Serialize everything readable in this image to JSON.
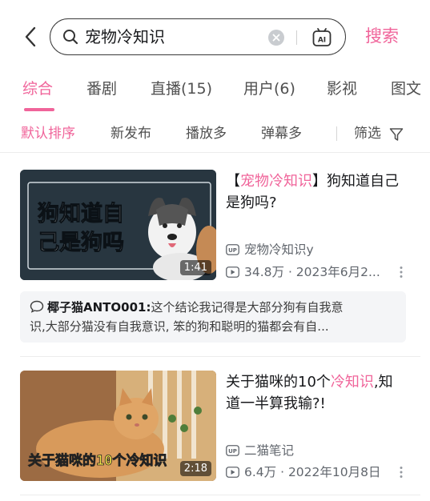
{
  "search": {
    "query": "宠物冷知识",
    "button_label": "搜索",
    "ai_label": "AI"
  },
  "tabs": [
    {
      "label": "综合",
      "active": true
    },
    {
      "label": "番剧",
      "active": false
    },
    {
      "label": "直播(15)",
      "active": false
    },
    {
      "label": "用户(6)",
      "active": false
    },
    {
      "label": "影视",
      "active": false
    },
    {
      "label": "图文",
      "active": false
    }
  ],
  "sort": {
    "options": [
      {
        "label": "默认排序",
        "active": true
      },
      {
        "label": "新发布",
        "active": false
      },
      {
        "label": "播放多",
        "active": false
      },
      {
        "label": "弹幕多",
        "active": false
      }
    ],
    "filter_label": "筛选"
  },
  "results": [
    {
      "title_pre": "【",
      "title_hl": "宠物冷知识",
      "title_post": "】狗知道自己是狗吗?",
      "thumb_text_line1": "狗知道自",
      "thumb_text_line2": "己是狗吗",
      "duration": "1:41",
      "uploader": "宠物冷知识y",
      "plays": "34.8万",
      "date": "2023年6月2...",
      "comment": {
        "user": "椰子猫ANTO001:",
        "line1": "这个结论我记得是大部分狗有自我意",
        "line2": "识,大部分猫没有自我意识, 笨的狗和聪明的猫都会有自..."
      }
    },
    {
      "title_pre": "关于猫咪的10个",
      "title_hl": "冷知识",
      "title_post": ",知道一半算我输?!",
      "thumb_caption": "关于猫咪的10个冷知识",
      "duration": "2:18",
      "uploader": "二猫笔记",
      "plays": "6.4万",
      "date": "2022年10月8日"
    }
  ],
  "colors": {
    "accent": "#f0649a",
    "text": "#18191c",
    "muted": "#61666d"
  }
}
